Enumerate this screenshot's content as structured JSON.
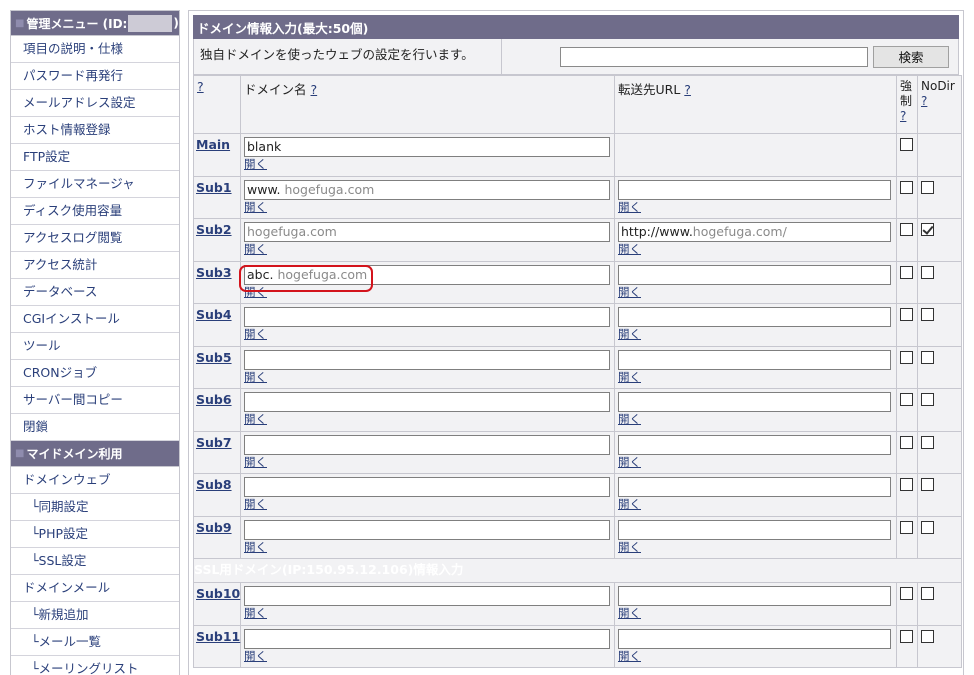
{
  "sidebar": {
    "header": "管理メニュー (ID:",
    "header_close": ")",
    "items": [
      {
        "label": "項目の説明・仕様"
      },
      {
        "label": "パスワード再発行"
      },
      {
        "label": "メールアドレス設定"
      },
      {
        "label": "ホスト情報登録"
      },
      {
        "label": "FTP設定"
      },
      {
        "label": "ファイルマネージャ"
      },
      {
        "label": "ディスク使用容量"
      },
      {
        "label": "アクセスログ閲覧"
      },
      {
        "label": "アクセス統計"
      },
      {
        "label": "データベース"
      },
      {
        "label": "CGIインストール"
      },
      {
        "label": "ツール"
      },
      {
        "label": "CRONジョブ"
      },
      {
        "label": "サーバー間コピー"
      },
      {
        "label": "閉鎖"
      }
    ],
    "section2_header": "マイドメイン利用",
    "section2_items": [
      {
        "label": "ドメインウェブ",
        "indent": false
      },
      {
        "label": "└同期設定",
        "indent": true
      },
      {
        "label": "└PHP設定",
        "indent": true
      },
      {
        "label": "└SSL設定",
        "indent": true
      },
      {
        "label": "ドメインメール",
        "indent": false
      },
      {
        "label": "└新規追加",
        "indent": true
      },
      {
        "label": "└メール一覧",
        "indent": true
      },
      {
        "label": "└メーリングリスト",
        "indent": true
      }
    ]
  },
  "main": {
    "title": "ドメイン情報入力(最大:50個)",
    "description": "独自ドメインを使ったウェブの設定を行います。",
    "search_button": "検索",
    "columns": {
      "help": "?",
      "domain": "ドメイン名",
      "url": "転送先URL",
      "force_1": "強",
      "force_2": "制",
      "nodir": "NoDir"
    },
    "open_label": "開く",
    "rows": [
      {
        "label": "Main",
        "prefix": "blank",
        "domain_hint": "",
        "url_prefix": "",
        "url_hint": "",
        "force": false,
        "nodir": null
      },
      {
        "label": "Sub1",
        "prefix": "www.",
        "domain_hint": "hogefuga.com",
        "url_prefix": "",
        "url_hint": "",
        "force": false,
        "nodir": false
      },
      {
        "label": "Sub2",
        "prefix": "",
        "domain_hint": "hogefuga.com",
        "url_prefix": "http://www.",
        "url_hint": "hogefuga.com/",
        "force": false,
        "nodir": true
      },
      {
        "label": "Sub3",
        "prefix": "abc.",
        "domain_hint": "hogefuga.com",
        "url_prefix": "",
        "url_hint": "",
        "force": false,
        "nodir": false
      },
      {
        "label": "Sub4",
        "prefix": "",
        "domain_hint": "",
        "url_prefix": "",
        "url_hint": "",
        "force": false,
        "nodir": false
      },
      {
        "label": "Sub5",
        "prefix": "",
        "domain_hint": "",
        "url_prefix": "",
        "url_hint": "",
        "force": false,
        "nodir": false
      },
      {
        "label": "Sub6",
        "prefix": "",
        "domain_hint": "",
        "url_prefix": "",
        "url_hint": "",
        "force": false,
        "nodir": false
      },
      {
        "label": "Sub7",
        "prefix": "",
        "domain_hint": "",
        "url_prefix": "",
        "url_hint": "",
        "force": false,
        "nodir": false
      },
      {
        "label": "Sub8",
        "prefix": "",
        "domain_hint": "",
        "url_prefix": "",
        "url_hint": "",
        "force": false,
        "nodir": false
      },
      {
        "label": "Sub9",
        "prefix": "",
        "domain_hint": "",
        "url_prefix": "",
        "url_hint": "",
        "force": false,
        "nodir": false
      }
    ],
    "ssl_title": "SSL用ドメイン(IP:150.95.12.106)情報入力",
    "ssl_rows": [
      {
        "label": "Sub10",
        "prefix": "",
        "domain_hint": "",
        "url_prefix": "",
        "url_hint": "",
        "force": false,
        "nodir": false
      },
      {
        "label": "Sub11",
        "prefix": "",
        "domain_hint": "",
        "url_prefix": "",
        "url_hint": "",
        "force": false,
        "nodir": false
      }
    ]
  },
  "colors": {
    "header_bg": "#6f6c8a",
    "link": "#2a3f7a",
    "highlight": "#d3131c"
  }
}
